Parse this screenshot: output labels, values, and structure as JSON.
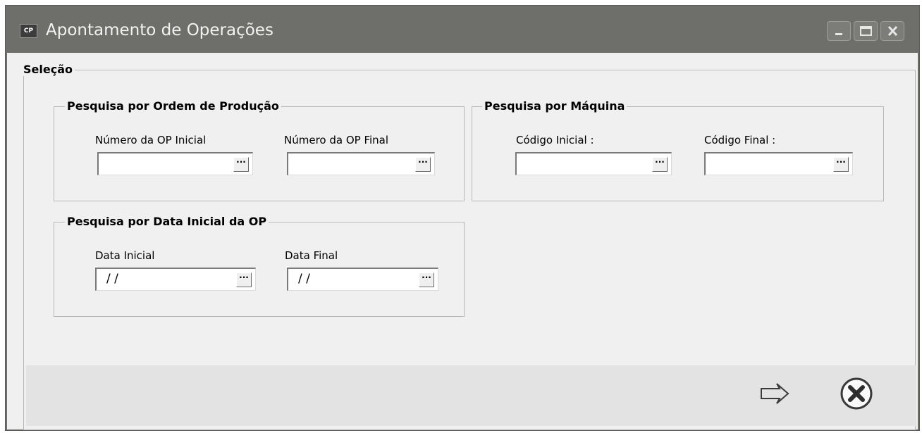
{
  "window": {
    "title": "Apontamento de Operações",
    "icon_text": "CP",
    "icon": "app-cp-icon"
  },
  "titlebar_buttons": {
    "minimize_icon": "minimize-icon",
    "maximize_icon": "maximize-icon",
    "close_icon": "close-icon"
  },
  "selection": {
    "label": "Seleção",
    "op_group": {
      "label": "Pesquisa por Ordem de Produção",
      "initial_label": "Número da OP Inicial",
      "initial_value": "",
      "final_label": "Número da OP Final",
      "final_value": ""
    },
    "machine_group": {
      "label": "Pesquisa por Máquina",
      "initial_label": "Código Inicial :",
      "initial_value": "",
      "final_label": "Código Final :",
      "final_value": ""
    },
    "date_group": {
      "label": "Pesquisa por Data Inicial da OP",
      "initial_label": "Data Inicial",
      "initial_value": " / /",
      "final_label": "Data Final",
      "final_value": " / /"
    },
    "lookup_label": "···"
  },
  "footer": {
    "confirm_icon": "arrow-right-icon",
    "cancel_icon": "close-circle-icon"
  },
  "colors": {
    "titlebar": "#6e6e6b",
    "client": "#f0f0f0",
    "footer": "#e3e3e3"
  }
}
